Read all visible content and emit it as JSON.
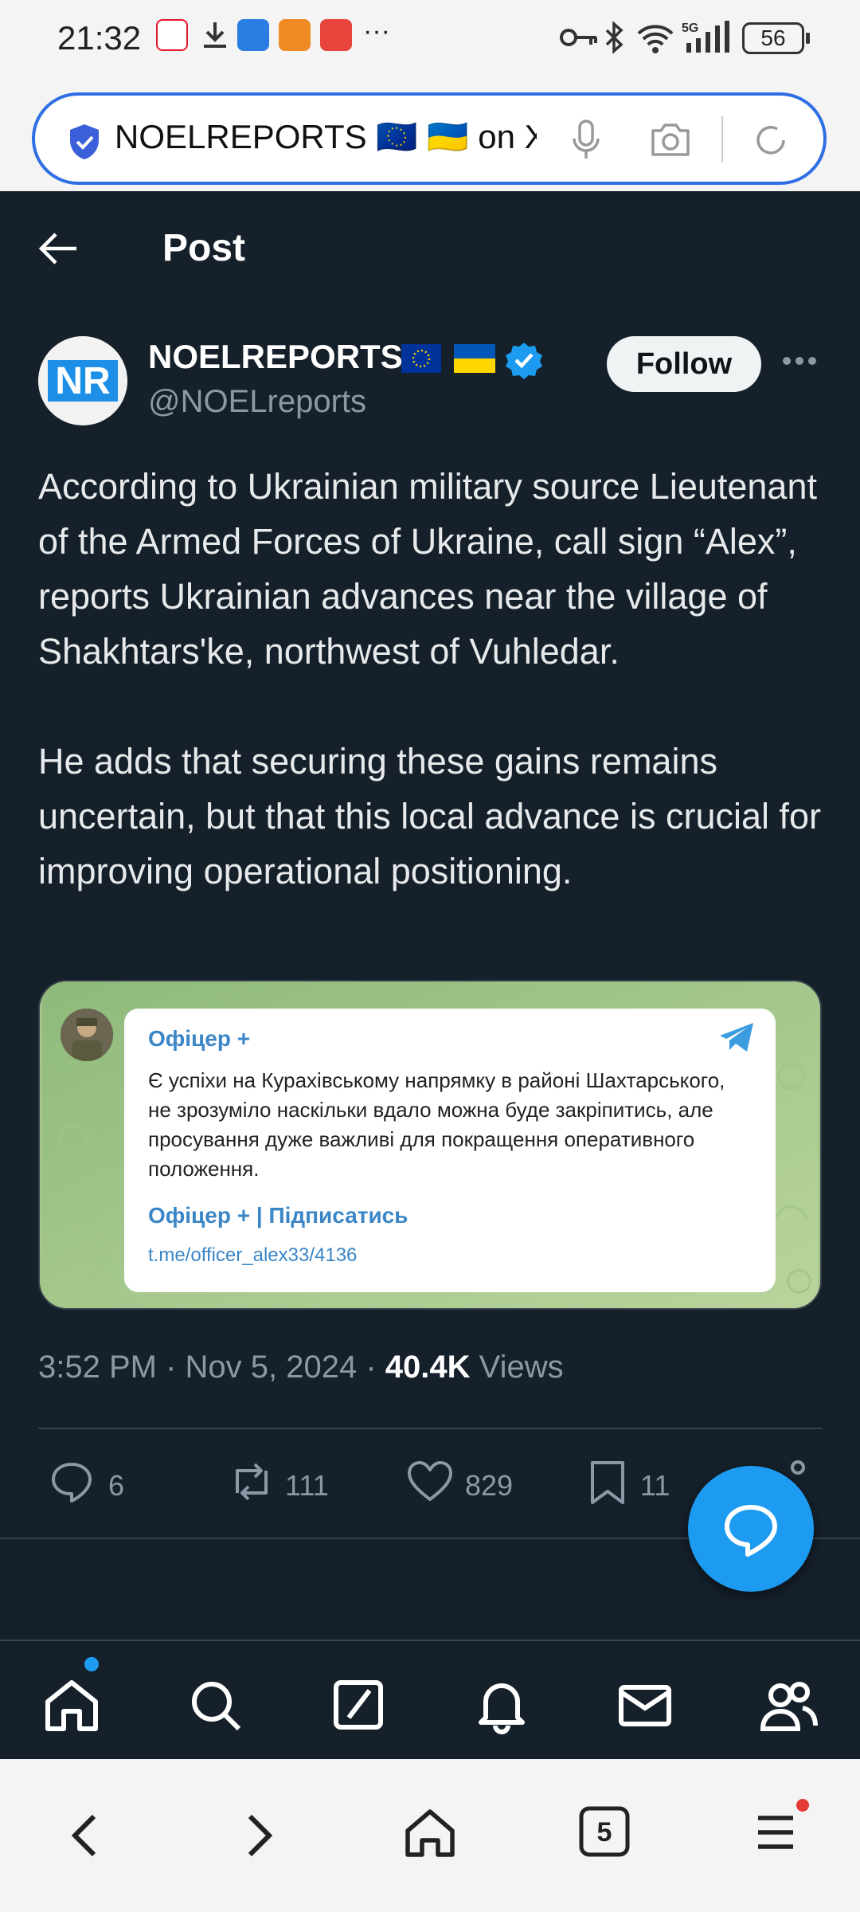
{
  "status_bar": {
    "time": "21:32",
    "battery": "56",
    "network": "5G"
  },
  "url_bar": {
    "text": "NOELREPORTS 🇪🇺 🇺🇦 on X"
  },
  "header": {
    "title": "Post"
  },
  "author": {
    "avatar_text": "NR",
    "name": "NOELREPORTS",
    "handle": "@NOELreports",
    "follow_label": "Follow"
  },
  "tweet": {
    "text": "According to Ukrainian military source Lieutenant of the Armed Forces of Ukraine, call sign “Alex”, reports Ukrainian advances near the village of Shakhtars'ke, northwest of Vuhledar.\n\nHe adds that securing these gains remains uncertain, but that this local advance is crucial for improving operational positioning."
  },
  "media": {
    "channel": "Офіцер +",
    "message": "Є успіхи на Курахівському напрямку в районі Шахтарського, не зрозуміло наскільки вдало можна буде закріпитись, але просування дуже важливі для покращення оперативного положення.",
    "subscribe": "Офіцер + | Підписатись",
    "link": "t.me/officer_alex33/4136"
  },
  "meta": {
    "time": "3:52 PM",
    "date": "Nov 5, 2024",
    "views_count": "40.4K",
    "views_label": "Views"
  },
  "actions": {
    "replies": "6",
    "reposts": "111",
    "likes": "829",
    "bookmarks": "11"
  },
  "browser_bar": {
    "tabs_count": "5"
  },
  "colors": {
    "background": "#15202b",
    "accent": "#1d9bf0",
    "url_border": "#2f6fe4",
    "telegram_blue": "#3b86c6"
  }
}
